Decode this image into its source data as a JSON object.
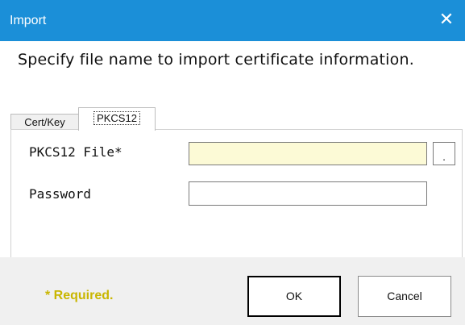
{
  "window": {
    "title": "Import",
    "close_icon": "close-icon",
    "close_glyph": "✕"
  },
  "instruction": "Specify file name to import certificate information.",
  "tabs": [
    {
      "label": "Cert/Key",
      "selected": false
    },
    {
      "label": "PKCS12",
      "selected": true
    }
  ],
  "form": {
    "file_label": "PKCS12 File*",
    "file_value": "",
    "browse_label": ".",
    "password_label": "Password",
    "password_value": ""
  },
  "footer": {
    "required_note": "* Required.",
    "ok_label": "OK",
    "cancel_label": "Cancel"
  },
  "colors": {
    "titlebar": "#1b8fd8",
    "required_text": "#c9b600",
    "file_field_bg": "#fcfad6"
  }
}
